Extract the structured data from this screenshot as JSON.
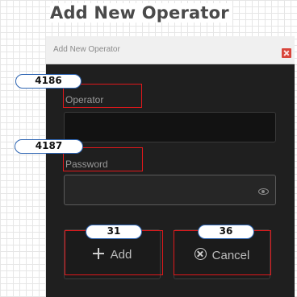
{
  "page_title": "Add New Operator",
  "dialog": {
    "title": "Add New Operator",
    "operator_label": "Operator",
    "operator_value": "",
    "password_label": "Password",
    "password_value": "",
    "add_label": "Add",
    "cancel_label": "Cancel",
    "accent_color": "#d8453b"
  },
  "annotations": {
    "operator_label_id": "4186",
    "password_label_id": "4187",
    "add_button_id": "31",
    "cancel_button_id": "36",
    "highlight_color": "#e0181b",
    "badge_border_color": "#2f66b3"
  }
}
